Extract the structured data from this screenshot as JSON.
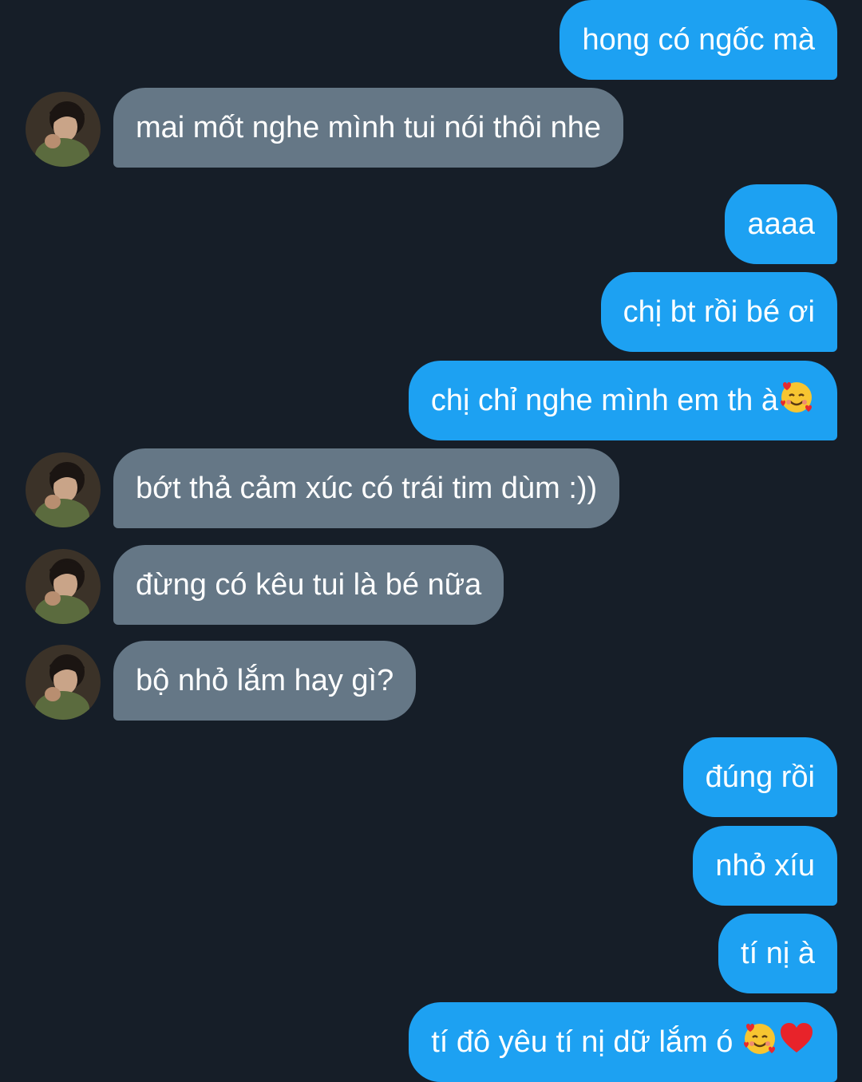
{
  "conversation": {
    "messages": [
      {
        "from": "me",
        "text": "hong có ngốc mà"
      },
      {
        "from": "them",
        "text": "mai mốt nghe mình tui nói thôi nhe"
      },
      {
        "from": "me",
        "text": "aaaa"
      },
      {
        "from": "me",
        "text": "chị bt rồi bé ơi"
      },
      {
        "from": "me",
        "text": "chị chỉ nghe mình em th à",
        "emoji": [
          "smiling-face-with-hearts"
        ]
      },
      {
        "from": "them",
        "text": "bớt thả cảm xúc có trái tim dùm :))"
      },
      {
        "from": "them",
        "text": "đừng có kêu tui là bé nữa"
      },
      {
        "from": "them",
        "text": "bộ nhỏ lắm hay gì?"
      },
      {
        "from": "me",
        "text": "đúng rồi"
      },
      {
        "from": "me",
        "text": "nhỏ xíu"
      },
      {
        "from": "me",
        "text": "tí nị à"
      },
      {
        "from": "me",
        "text": "tí đô yêu tí nị dữ lắm ó ",
        "emoji": [
          "smiling-face-with-hearts",
          "red-heart"
        ]
      }
    ]
  },
  "colors": {
    "background": "#161e28",
    "outgoing_bubble": "#1da1f2",
    "incoming_bubble": "#657786",
    "text": "#ffffff"
  }
}
